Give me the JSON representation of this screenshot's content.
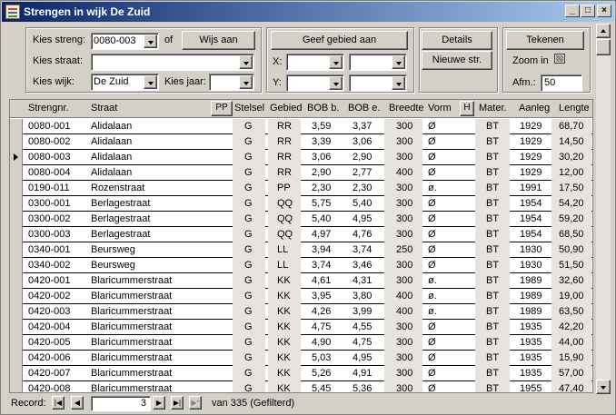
{
  "window": {
    "title": "Strengen in wijk De Zuid"
  },
  "filters": {
    "streng_label": "Kies streng:",
    "streng_value": "0080-003",
    "of_label": "of",
    "wijs_aan_label": "Wijs aan",
    "straat_label": "Kies straat:",
    "straat_value": "",
    "wijk_label": "Kies wijk:",
    "wijk_value": "De Zuid",
    "jaar_label": "Kies jaar:",
    "jaar_value": ""
  },
  "gebied": {
    "button_label": "Geef gebied aan",
    "x_label": "X:",
    "y_label": "Y:"
  },
  "actions": {
    "details_label": "Details",
    "nieuwe_label": "Nieuwe str."
  },
  "tekenen": {
    "button_label": "Tekenen",
    "zoom_label": "Zoom in",
    "afm_label": "Afm.:",
    "afm_value": "50"
  },
  "table": {
    "headers": {
      "strengnr": "Strengnr.",
      "straat": "Straat",
      "pp": "PP",
      "stelsel": "Stelsel",
      "gebied": "Gebied",
      "bob_b": "BOB b.",
      "bob_e": "BOB e.",
      "breedte": "Breedte",
      "vorm": "Vorm",
      "h": "H",
      "mater": "Mater.",
      "aanleg": "Aanleg",
      "lengte": "Lengte"
    },
    "rows": [
      [
        "0080-001",
        "Alidalaan",
        "G",
        "RR",
        "3,59",
        "3,37",
        "300",
        "Ø",
        "BT",
        "1929",
        "68,70"
      ],
      [
        "0080-002",
        "Alidalaan",
        "G",
        "RR",
        "3,39",
        "3,06",
        "300",
        "Ø",
        "BT",
        "1929",
        "14,50"
      ],
      [
        "0080-003",
        "Alidalaan",
        "G",
        "RR",
        "3,06",
        "2,90",
        "300",
        "Ø",
        "BT",
        "1929",
        "30,20"
      ],
      [
        "0080-004",
        "Alidalaan",
        "G",
        "RR",
        "2,90",
        "2,77",
        "400",
        "Ø",
        "BT",
        "1929",
        "12,00"
      ],
      [
        "0190-011",
        "Rozenstraat",
        "G",
        "PP",
        "2,30",
        "2,30",
        "300",
        "ø.",
        "BT",
        "1991",
        "17,50"
      ],
      [
        "0300-001",
        "Berlagestraat",
        "G",
        "QQ",
        "5,75",
        "5,40",
        "300",
        "Ø",
        "BT",
        "1954",
        "54,20"
      ],
      [
        "0300-002",
        "Berlagestraat",
        "G",
        "QQ",
        "5,40",
        "4,95",
        "300",
        "Ø",
        "BT",
        "1954",
        "59,20"
      ],
      [
        "0300-003",
        "Berlagestraat",
        "G",
        "QQ",
        "4,97",
        "4,76",
        "300",
        "Ø",
        "BT",
        "1954",
        "68,50"
      ],
      [
        "0340-001",
        "Beursweg",
        "G",
        "LL",
        "3,94",
        "3,74",
        "250",
        "Ø",
        "BT",
        "1930",
        "50,90"
      ],
      [
        "0340-002",
        "Beursweg",
        "G",
        "LL",
        "3,74",
        "3,46",
        "300",
        "Ø",
        "BT",
        "1930",
        "51,50"
      ],
      [
        "0420-001",
        "Blaricummerstraat",
        "G",
        "KK",
        "4,61",
        "4,31",
        "300",
        "ø.",
        "BT",
        "1989",
        "32,60"
      ],
      [
        "0420-002",
        "Blaricummerstraat",
        "G",
        "KK",
        "3,95",
        "3,80",
        "400",
        "ø.",
        "BT",
        "1989",
        "19,00"
      ],
      [
        "0420-003",
        "Blaricummerstraat",
        "G",
        "KK",
        "4,26",
        "3,99",
        "400",
        "ø.",
        "BT",
        "1989",
        "63,50"
      ],
      [
        "0420-004",
        "Blaricummerstraat",
        "G",
        "KK",
        "4,75",
        "4,55",
        "300",
        "Ø",
        "BT",
        "1935",
        "42,20"
      ],
      [
        "0420-005",
        "Blaricummerstraat",
        "G",
        "KK",
        "4,90",
        "4,75",
        "300",
        "Ø",
        "BT",
        "1935",
        "44,00"
      ],
      [
        "0420-006",
        "Blaricummerstraat",
        "G",
        "KK",
        "5,03",
        "4,95",
        "300",
        "Ø",
        "BT",
        "1935",
        "15,90"
      ],
      [
        "0420-007",
        "Blaricummerstraat",
        "G",
        "KK",
        "5,26",
        "4,91",
        "300",
        "Ø",
        "BT",
        "1935",
        "57,00"
      ],
      [
        "0420-008",
        "Blaricummerstraat",
        "G",
        "KK",
        "5,45",
        "5,36",
        "300",
        "Ø",
        "BT",
        "1955",
        "47,40"
      ]
    ],
    "current_row_index": 2
  },
  "navigation": {
    "record_label": "Record:",
    "record_value": "3",
    "of_text": "van  335 (Gefilterd)"
  }
}
